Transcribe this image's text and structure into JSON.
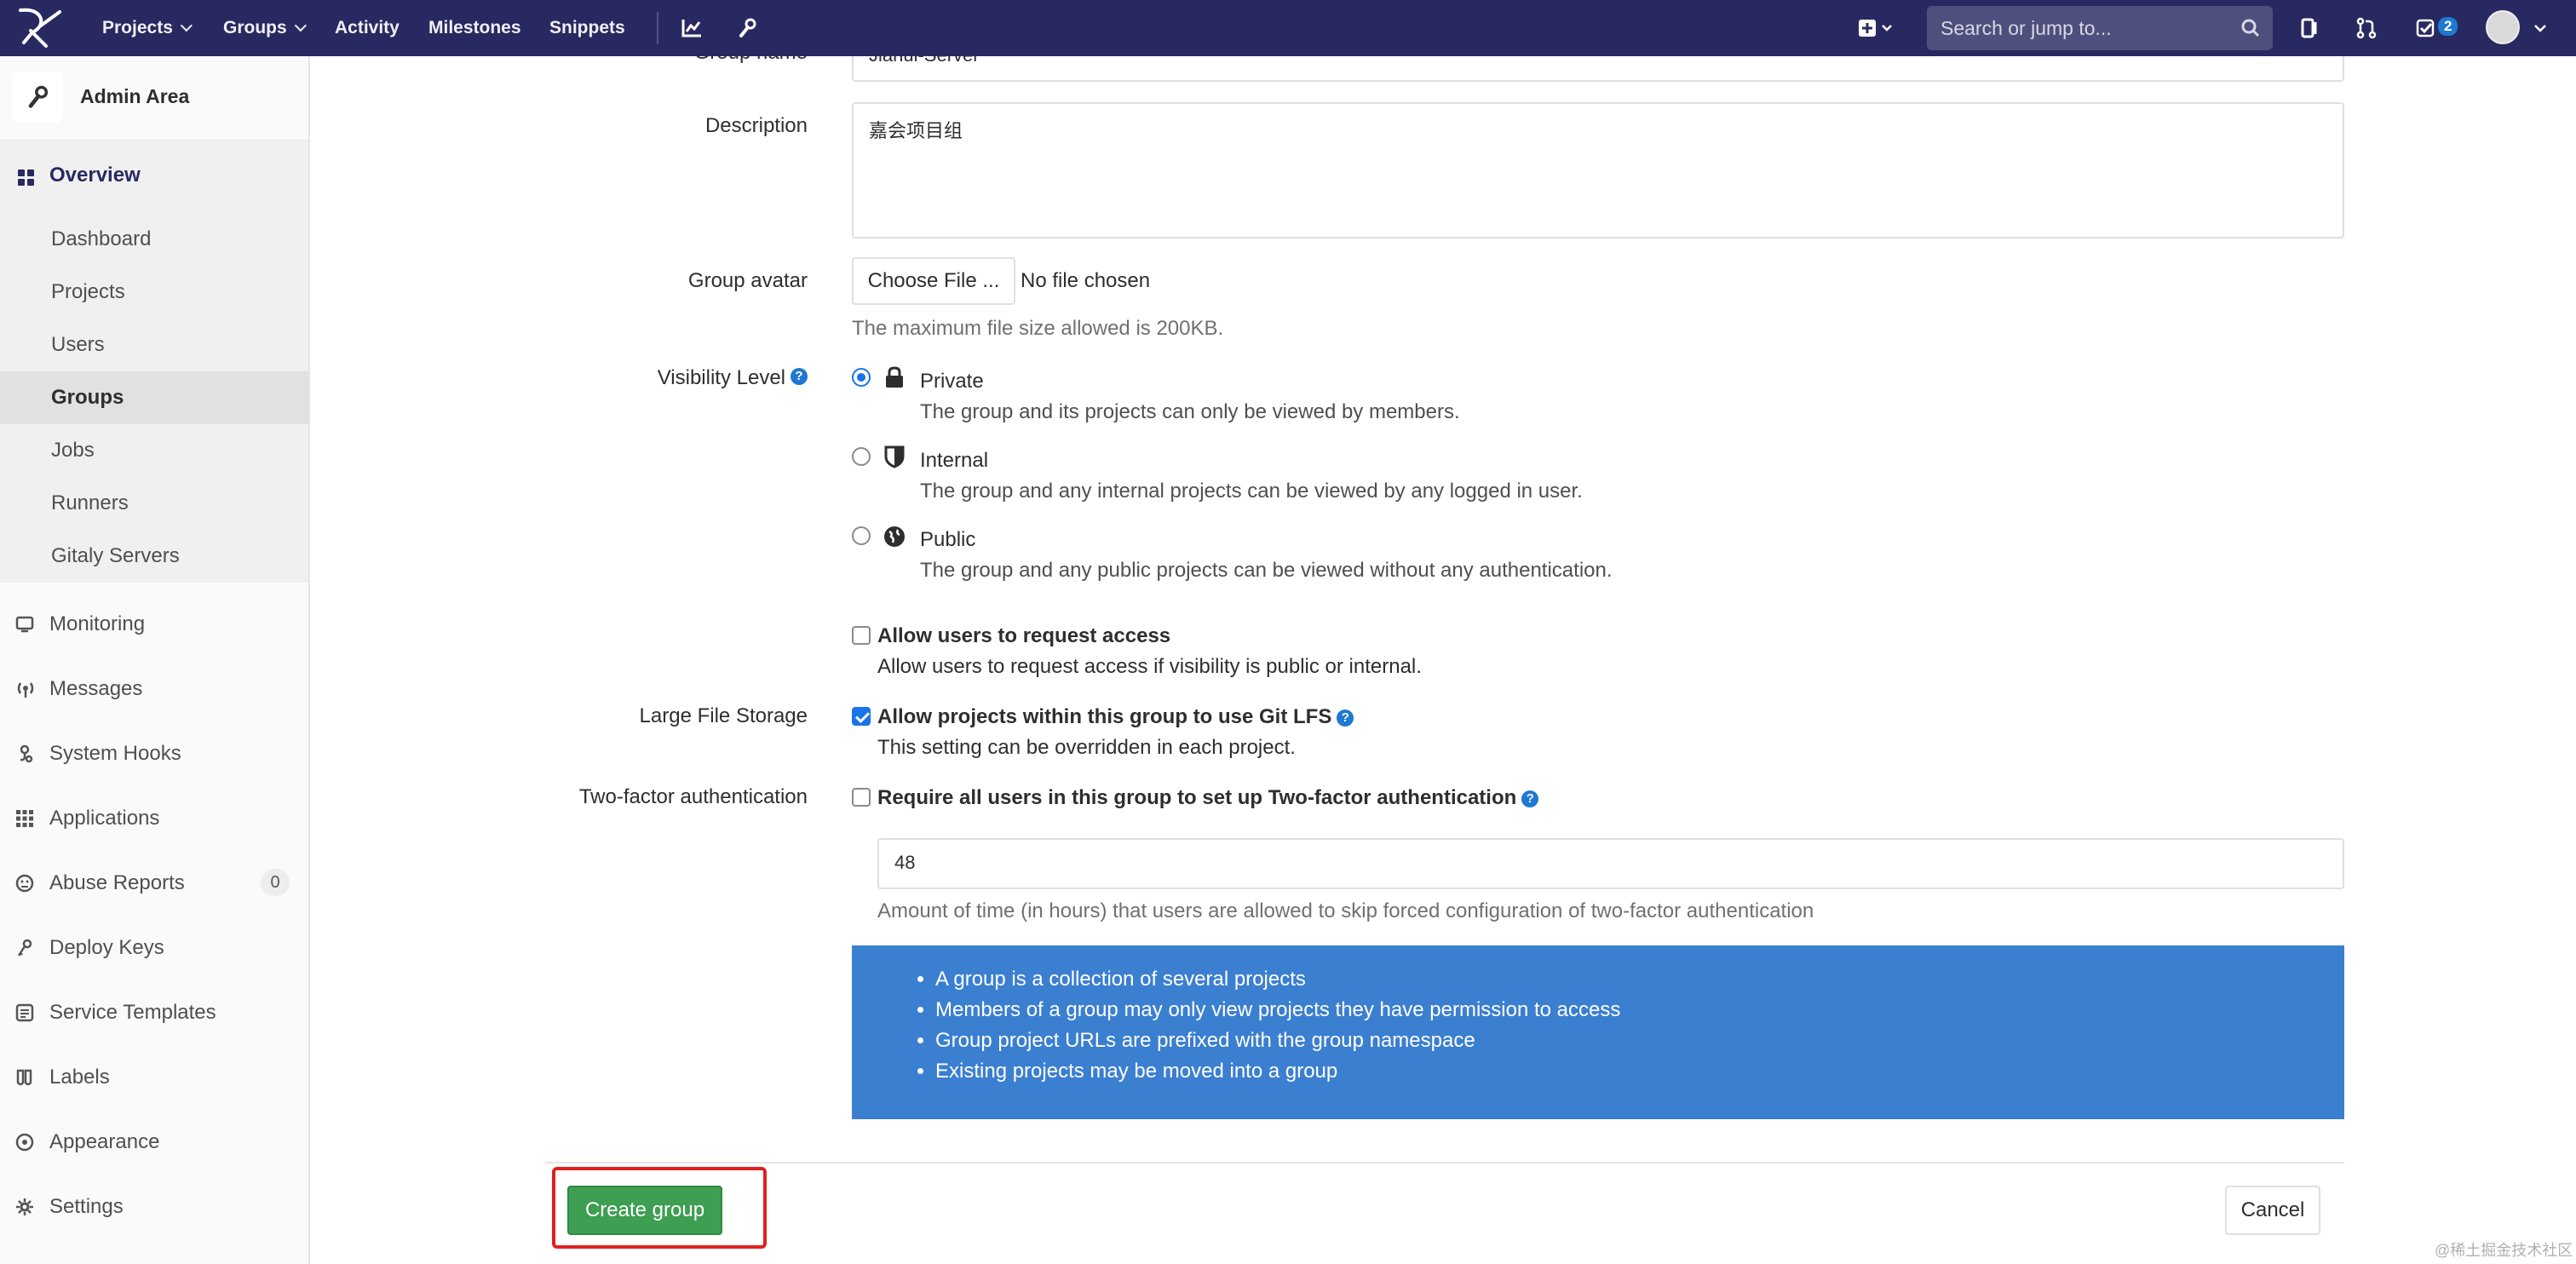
{
  "nav": {
    "projects": "Projects",
    "groups": "Groups",
    "activity": "Activity",
    "milestones": "Milestones",
    "snippets": "Snippets",
    "search_placeholder": "Search or jump to...",
    "todo_count": "2"
  },
  "sidebar": {
    "title": "Admin Area",
    "overview": "Overview",
    "subitems": [
      "Dashboard",
      "Projects",
      "Users",
      "Groups",
      "Jobs",
      "Runners",
      "Gitaly Servers"
    ],
    "active_subitem": "Groups",
    "items": [
      {
        "label": "Monitoring",
        "icon": "monitor-icon"
      },
      {
        "label": "Messages",
        "icon": "broadcast-icon"
      },
      {
        "label": "System Hooks",
        "icon": "hook-icon"
      },
      {
        "label": "Applications",
        "icon": "grid-icon"
      },
      {
        "label": "Abuse Reports",
        "icon": "slight-frown-icon",
        "count": "0"
      },
      {
        "label": "Deploy Keys",
        "icon": "key-icon"
      },
      {
        "label": "Service Templates",
        "icon": "template-icon"
      },
      {
        "label": "Labels",
        "icon": "labels-icon"
      },
      {
        "label": "Appearance",
        "icon": "appearance-icon"
      },
      {
        "label": "Settings",
        "icon": "settings-icon"
      }
    ]
  },
  "form": {
    "group_name_label": "Group name",
    "group_name_value": "Jiahui-Server",
    "description_label": "Description",
    "description_value": "嘉会项目组",
    "avatar_label": "Group avatar",
    "choose_file": "Choose File ...",
    "no_file": "No file chosen",
    "max_size_help": "The maximum file size allowed is 200KB.",
    "visibility_label": "Visibility Level",
    "visibility_options": [
      {
        "title": "Private",
        "desc": "The group and its projects can only be viewed by members.",
        "checked": true,
        "icon": "lock-icon"
      },
      {
        "title": "Internal",
        "desc": "The group and any internal projects can be viewed by any logged in user.",
        "checked": false,
        "icon": "shield-icon"
      },
      {
        "title": "Public",
        "desc": "The group and any public projects can be viewed without any authentication.",
        "checked": false,
        "icon": "globe-icon"
      }
    ],
    "request_access_title": "Allow users to request access",
    "request_access_desc": "Allow users to request access if visibility is public or internal.",
    "lfs_label": "Large File Storage",
    "lfs_title": "Allow projects within this group to use Git LFS",
    "lfs_desc": "This setting can be overridden in each project.",
    "twofa_label": "Two-factor authentication",
    "twofa_title": "Require all users in this group to set up Two-factor authentication",
    "grace_value": "48",
    "grace_help": "Amount of time (in hours) that users are allowed to skip forced configuration of two-factor authentication",
    "info_items": [
      "A group is a collection of several projects",
      "Members of a group may only view projects they have permission to access",
      "Group project URLs are prefixed with the group namespace",
      "Existing projects may be moved into a group"
    ],
    "create_button": "Create group",
    "cancel_button": "Cancel"
  },
  "watermark": "@稀土掘金技术社区",
  "colors": {
    "nav_bg": "#292961",
    "info_bg": "#3b7fd1",
    "create_btn": "#3e9e52",
    "highlight": "#e02020",
    "accent": "#1f78d1"
  }
}
